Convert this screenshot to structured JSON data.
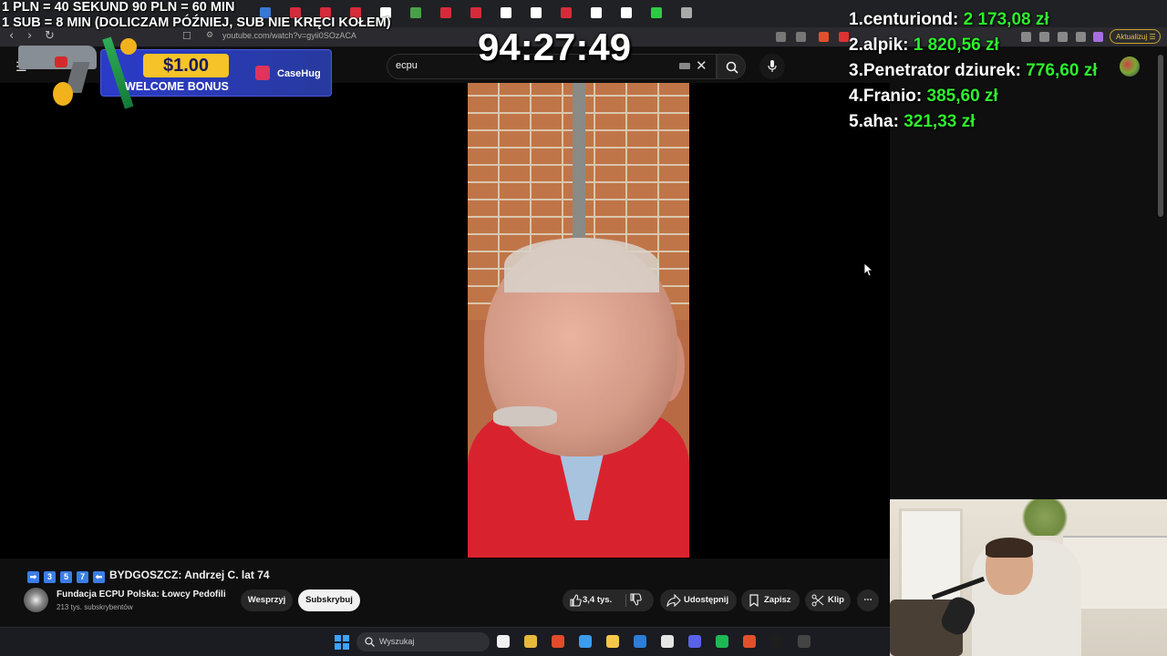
{
  "stream_overlay": {
    "rules_line1": "1 PLN =  40 SEKUND 90 PLN = 60 MIN",
    "rules_line2": "1 SUB = 8 MIN (DOLICZAM PÓŹNIEJ, SUB NIE KRĘCI KOŁEM)",
    "timer": "94:27:49",
    "leaderboard": [
      {
        "rank": "1.",
        "name": "centuriond:",
        "amount": "2 173,08 zł"
      },
      {
        "rank": "2.",
        "name": "alpik:",
        "amount": "1 820,56 zł"
      },
      {
        "rank": "3.",
        "name": "Penetrator dziurek:",
        "amount": "776,60 zł"
      },
      {
        "rank": "4.",
        "name": "Franio:",
        "amount": "385,60 zł"
      },
      {
        "rank": "5.",
        "name": "aha:",
        "amount": "321,33 zł"
      }
    ]
  },
  "promo": {
    "price": "$1.00",
    "bonus_text": "WELCOME BONUS",
    "brand": "CaseHug"
  },
  "browser": {
    "url": "youtube.com/watch?v=gyii0SOzACA",
    "update_label": "Aktualizuj",
    "tab_favicon_colors": [
      "#3a78d6",
      "#d62b3a",
      "#d62b3a",
      "#d62b3a",
      "#fff",
      "#4aa04a",
      "#d62b3a",
      "#d62b3a",
      "#fff",
      "#fff",
      "#d62b3a",
      "#fff",
      "#fff",
      "#2ecc40",
      "#aaa"
    ]
  },
  "youtube": {
    "search_query": "ecpu",
    "video_title": "BYDGOSZCZ: Andrzej C. lat 74",
    "title_keys": [
      "➡",
      "3",
      "5",
      "7",
      "⬅"
    ],
    "channel_name": "Fundacja ECPU Polska: Łowcy Pedofili",
    "subscriber_count": "213 tys. subskrybentów",
    "support_label": "Wesprzyj",
    "subscribe_label": "Subskrybuj",
    "like_count": "3,4 tys.",
    "share_label": "Udostępnij",
    "save_label": "Zapisz",
    "clip_label": "Klip",
    "more_label": "⋯"
  },
  "taskbar": {
    "search_placeholder": "Wyszukaj",
    "app_colors": [
      "#f0f0f0",
      "#e7b83c",
      "#e24b2b",
      "#3a9cf0",
      "#f5c84a",
      "#2b7fd6",
      "#e5e5e5",
      "#5a62e8",
      "#1db954",
      "#e2502b",
      "#1d1d1d",
      "#444"
    ]
  },
  "colors": {
    "leaderboard_amount": "#2ef02e",
    "youtube_bg": "#0f0f0f",
    "subscribe_bg": "#f1f1f1"
  }
}
